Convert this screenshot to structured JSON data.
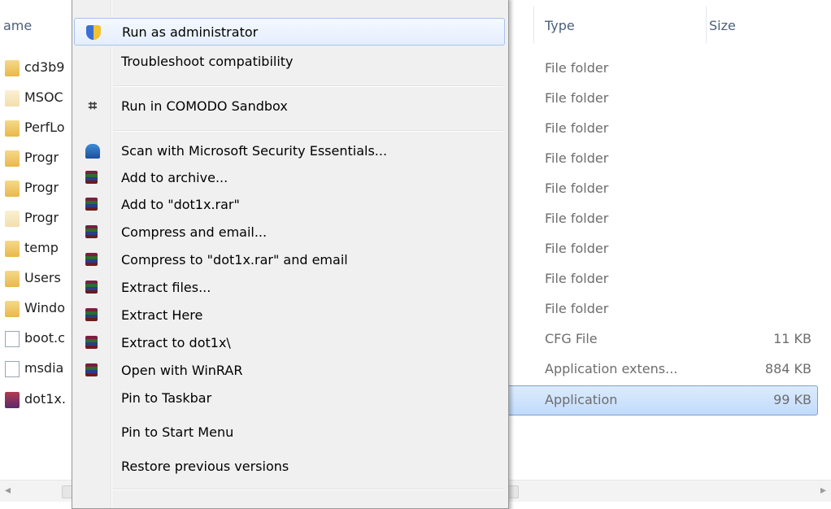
{
  "columns": {
    "name": "ame",
    "type": "Type",
    "size": "Size"
  },
  "files": [
    {
      "name": "cd3b9",
      "type": "File folder",
      "size": "",
      "icon": "folder-icon"
    },
    {
      "name": "MSOC",
      "type": "File folder",
      "size": "",
      "icon": "folder-icon"
    },
    {
      "name": "PerfLo",
      "type": "File folder",
      "size": "",
      "icon": "folder-icon"
    },
    {
      "name": "Progr",
      "type": "File folder",
      "size": "",
      "icon": "folder-icon"
    },
    {
      "name": "Progr",
      "type": "File folder",
      "size": "",
      "icon": "folder-icon"
    },
    {
      "name": "Progr",
      "type": "File folder",
      "size": "",
      "icon": "folder-icon"
    },
    {
      "name": "temp",
      "type": "File folder",
      "size": "",
      "icon": "folder-icon"
    },
    {
      "name": "Users",
      "type": "File folder",
      "size": "",
      "icon": "folder-icon"
    },
    {
      "name": "Windo",
      "type": "File folder",
      "size": "",
      "icon": "folder-icon"
    },
    {
      "name": "boot.c",
      "type": "CFG File",
      "size": "11 KB",
      "icon": "file-icon"
    },
    {
      "name": "msdia",
      "type": "Application extens...",
      "size": "884 KB",
      "icon": "dll-icon"
    },
    {
      "name": "dot1x.",
      "type": "Application",
      "size": "99 KB",
      "icon": "app-icon"
    }
  ],
  "menu": {
    "items": [
      {
        "label": "Run as administrator",
        "icon": "shield-icon"
      },
      {
        "label": "Troubleshoot compatibility",
        "icon": ""
      },
      {
        "label": "Run in COMODO Sandbox",
        "icon": "sandbox-icon"
      },
      {
        "label": "Scan with Microsoft Security Essentials...",
        "icon": "mse-icon"
      },
      {
        "label": "Add to archive...",
        "icon": "winrar-icon"
      },
      {
        "label": "Add to \"dot1x.rar\"",
        "icon": "winrar-icon"
      },
      {
        "label": "Compress and email...",
        "icon": "winrar-icon"
      },
      {
        "label": "Compress to \"dot1x.rar\" and email",
        "icon": "winrar-icon"
      },
      {
        "label": "Extract files...",
        "icon": "winrar-icon"
      },
      {
        "label": "Extract Here",
        "icon": "winrar-icon"
      },
      {
        "label": "Extract to dot1x\\",
        "icon": "winrar-icon"
      },
      {
        "label": "Open with WinRAR",
        "icon": "winrar-icon"
      },
      {
        "label": "Pin to Taskbar",
        "icon": ""
      },
      {
        "label": "Pin to Start Menu",
        "icon": ""
      },
      {
        "label": "Restore previous versions",
        "icon": ""
      }
    ]
  },
  "scrollbar": {
    "left_arrow": "◂",
    "right_arrow": "▸"
  }
}
